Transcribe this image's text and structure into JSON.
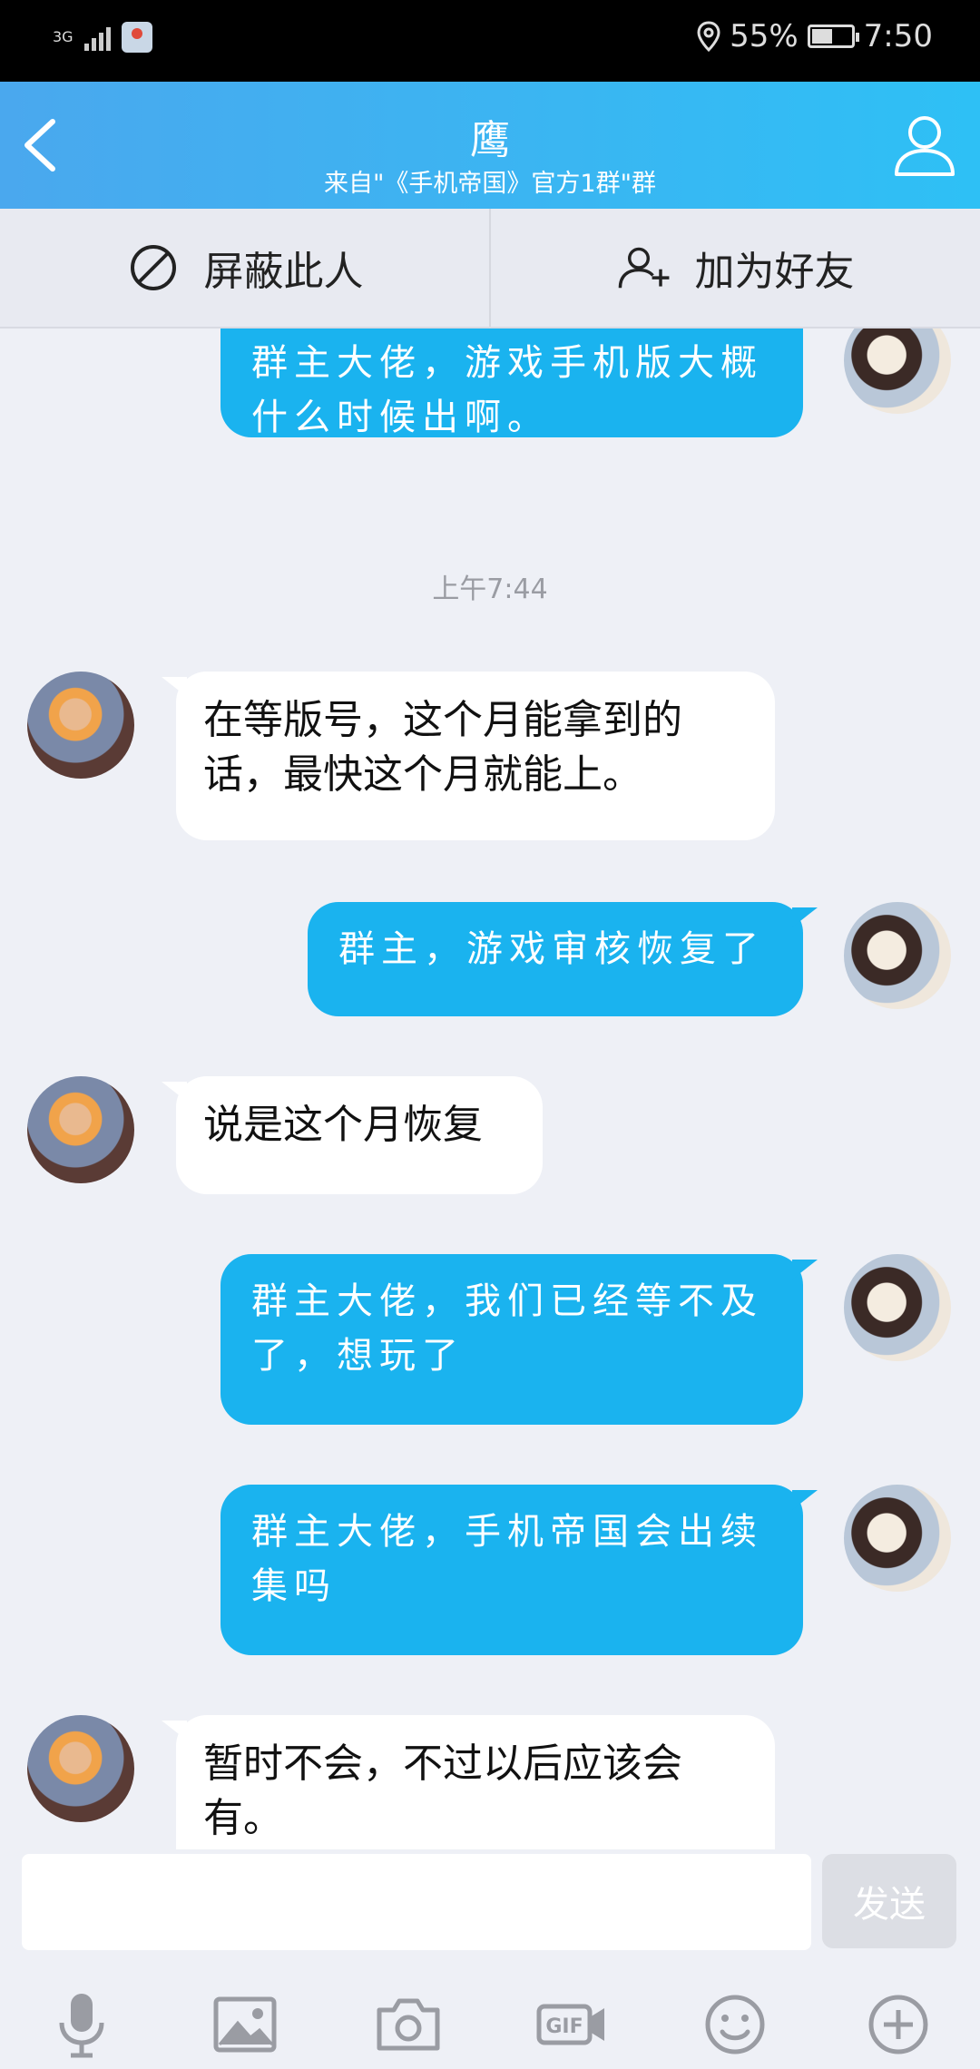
{
  "status_bar": {
    "network": "3G",
    "battery": "55%",
    "battery_level": 0.55,
    "time": "7:50"
  },
  "header": {
    "title": "鹰",
    "subtitle": "来自\"《手机帝国》官方1群\"群"
  },
  "actions": {
    "block_label": "屏蔽此人",
    "add_friend_label": "加为好友"
  },
  "chat": {
    "timestamp": "上午7:44",
    "messages": [
      {
        "sender": "self",
        "text": "群主大佬，游戏手机版大概什么时候出啊。"
      },
      {
        "sender": "other",
        "text": "在等版号，这个月能拿到的话，最快这个月就能上。"
      },
      {
        "sender": "self",
        "text": "群主，游戏审核恢复了"
      },
      {
        "sender": "other",
        "text": "说是这个月恢复"
      },
      {
        "sender": "self",
        "text": "群主大佬，我们已经等不及了，想玩了"
      },
      {
        "sender": "self",
        "text": "群主大佬，手机帝国会出续集吗"
      },
      {
        "sender": "other",
        "text": "暂时不会，不过以后应该会有。"
      }
    ]
  },
  "input": {
    "value": "",
    "send_label": "发送"
  },
  "toolbar": {
    "gif_label": "GIF",
    "icons": [
      "microphone-icon",
      "image-icon",
      "camera-icon",
      "gif-icon",
      "emoji-icon",
      "plus-icon"
    ]
  },
  "colors": {
    "header_start": "#4aa8ee",
    "header_end": "#2ec0f5",
    "self_bubble": "#1ab3ef",
    "other_bubble": "#ffffff",
    "background": "#eef0f6"
  }
}
